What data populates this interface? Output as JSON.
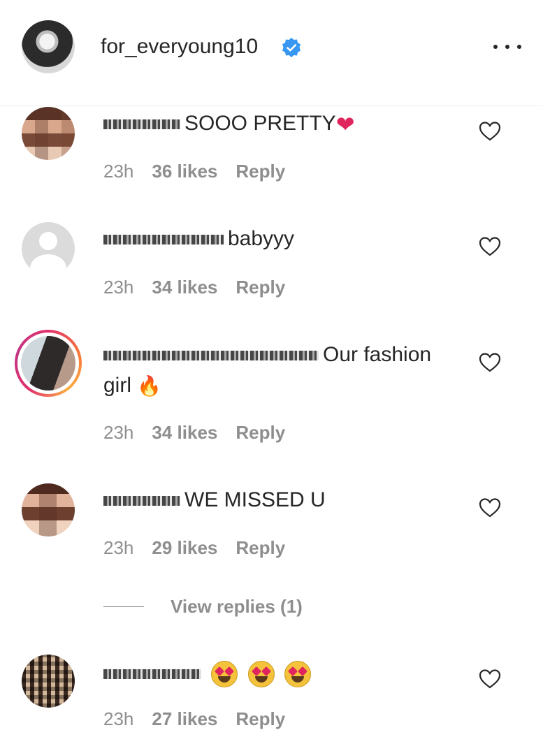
{
  "post": {
    "username": "for_everyoung10",
    "verified": true
  },
  "comments": [
    {
      "username": "izumi.s",
      "text": "SOOO PRETTY",
      "emoji": "❤",
      "time": "23h",
      "likes": "36 likes",
      "reply": "Reply"
    },
    {
      "username": "andcoalaby",
      "text": "babyyy",
      "time": "23h",
      "likes": "34 likes",
      "reply": "Reply"
    },
    {
      "username": "wonyoung love",
      "text_line1": "Our fashion",
      "text_line2": "girl",
      "emoji": "🔥",
      "time": "23h",
      "likes": "34 likes",
      "reply": "Reply"
    },
    {
      "username": "ivonelv",
      "text": "WE MISSED U",
      "time": "23h",
      "likes": "29 likes",
      "reply": "Reply",
      "view_replies": "View replies (1)"
    },
    {
      "username": "anvnnsta",
      "emoji_count": 3,
      "time": "23h",
      "likes": "27 likes",
      "reply": "Reply"
    }
  ],
  "colors": {
    "text": "#262626",
    "muted": "#8e8e8e",
    "verified_blue": "#3897f0",
    "heart": "#e0245e"
  },
  "icons": [
    "verified-badge-icon",
    "more-options-icon",
    "heart-outline-icon",
    "default-avatar-icon"
  ]
}
